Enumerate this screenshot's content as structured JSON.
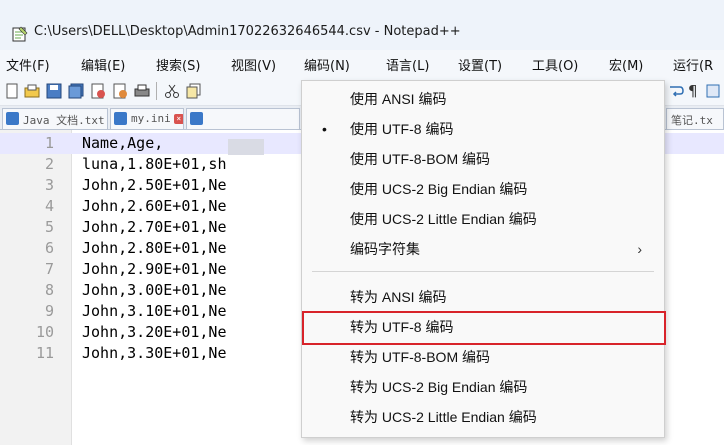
{
  "window": {
    "title": "C:\\Users\\DELL\\Desktop\\Admin17022632646544.csv - Notepad++"
  },
  "menubar": {
    "items": [
      "文件(F)",
      "编辑(E)",
      "搜索(S)",
      "视图(V)",
      "编码(N)",
      "语言(L)",
      "设置(T)",
      "工具(O)",
      "宏(M)",
      "运行(R"
    ]
  },
  "tabs": [
    {
      "label": "Java 文档.txt"
    },
    {
      "label": "my.ini"
    },
    {
      "label": "笔记.tx"
    }
  ],
  "editor": {
    "lines": [
      {
        "num": "1",
        "text": "Name,Age,"
      },
      {
        "num": "2",
        "text": "luna,1.80E+01,sh"
      },
      {
        "num": "3",
        "text": "John,2.50E+01,Ne"
      },
      {
        "num": "4",
        "text": "John,2.60E+01,Ne"
      },
      {
        "num": "5",
        "text": "John,2.70E+01,Ne"
      },
      {
        "num": "6",
        "text": "John,2.80E+01,Ne"
      },
      {
        "num": "7",
        "text": "John,2.90E+01,Ne"
      },
      {
        "num": "8",
        "text": "John,3.00E+01,Ne"
      },
      {
        "num": "9",
        "text": "John,3.10E+01,Ne"
      },
      {
        "num": "10",
        "text": "John,3.20E+01,Ne"
      },
      {
        "num": "11",
        "text": "John,3.30E+01,Ne"
      }
    ]
  },
  "encoding_menu": {
    "items": [
      {
        "label": "使用 ANSI 编码",
        "checked": false
      },
      {
        "label": "使用 UTF-8 编码",
        "checked": true
      },
      {
        "label": "使用 UTF-8-BOM 编码",
        "checked": false
      },
      {
        "label": "使用 UCS-2 Big Endian 编码",
        "checked": false
      },
      {
        "label": "使用 UCS-2 Little Endian 编码",
        "checked": false
      },
      {
        "label": "编码字符集",
        "submenu": true
      },
      {
        "label": "转为 ANSI 编码"
      },
      {
        "label": "转为 UTF-8 编码",
        "highlighted": true
      },
      {
        "label": "转为 UTF-8-BOM 编码"
      },
      {
        "label": "转为 UCS-2 Big Endian 编码"
      },
      {
        "label": "转为 UCS-2 Little Endian 编码"
      }
    ],
    "check_mark": "•",
    "submenu_arrow": "›"
  },
  "colors": {
    "highlight_border": "#d8232a",
    "current_line": "#e8e8ff"
  }
}
